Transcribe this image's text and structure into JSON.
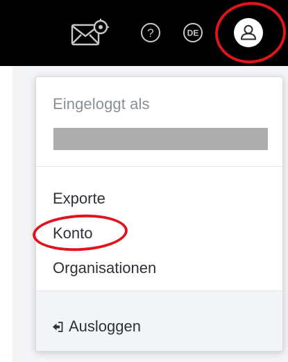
{
  "topbar": {
    "icons": {
      "mail": "mail-settings-icon",
      "help": "help-icon",
      "language": "language-icon",
      "account": "user-icon"
    },
    "language_code": "DE"
  },
  "account_menu": {
    "logged_in_label": "Eingeloggt als",
    "items": [
      {
        "label": "Exporte"
      },
      {
        "label": "Konto"
      },
      {
        "label": "Organisationen"
      }
    ],
    "logout_label": "Ausloggen",
    "logout_icon": "logout-icon"
  },
  "colors": {
    "topbar": "#000000",
    "annotation": "#e0141b",
    "redacted": "#adadad",
    "footer": "#f3f4f6"
  }
}
